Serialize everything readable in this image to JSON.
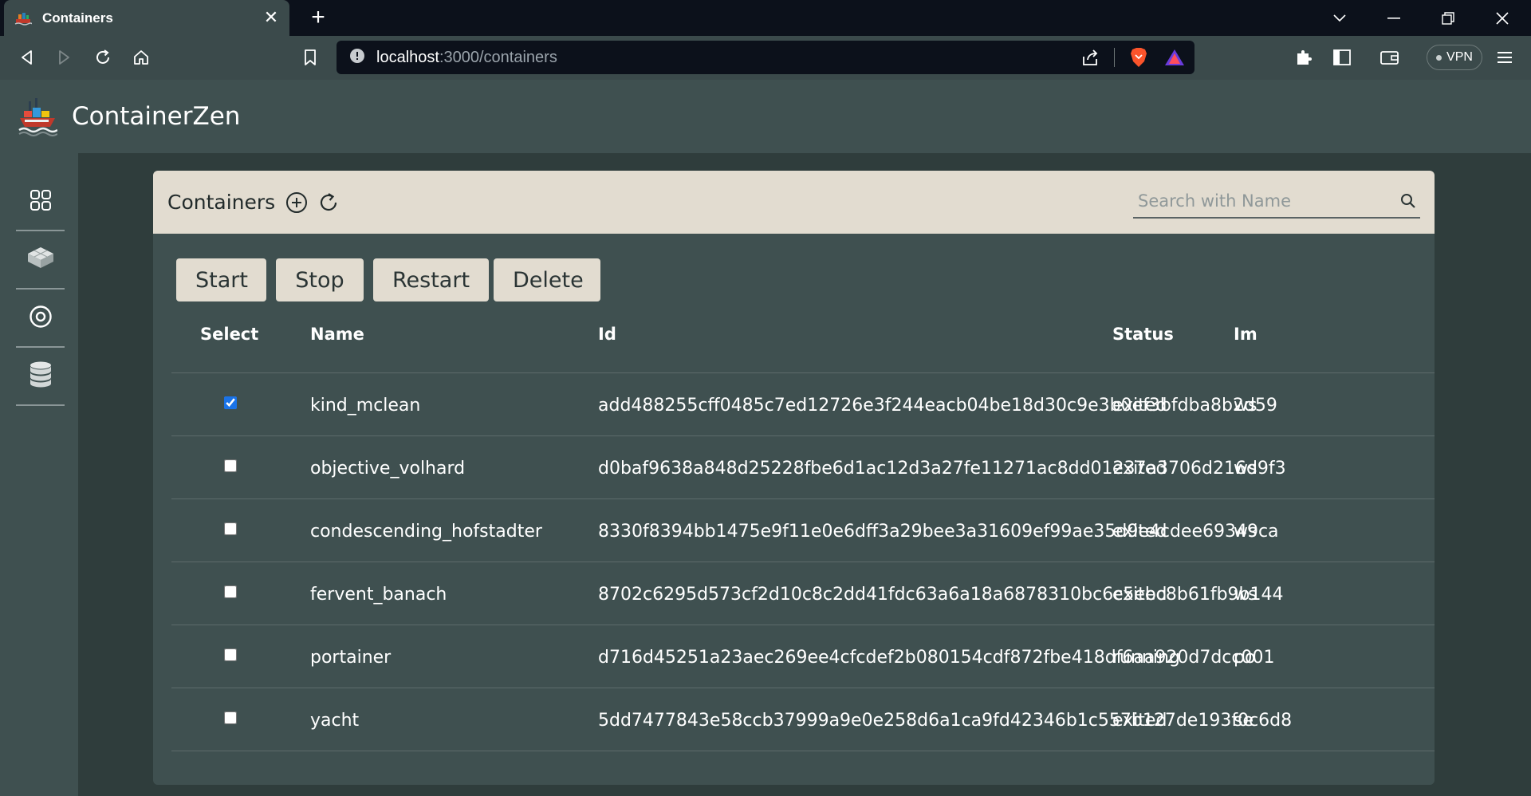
{
  "browser": {
    "tab_title": "Containers",
    "tab_close": "✕",
    "new_tab": "+",
    "url_host": "localhost",
    "url_path": ":3000/containers",
    "vpn_label": "VPN"
  },
  "app": {
    "title": "ContainerZen"
  },
  "sidebar": {
    "items": [
      {
        "icon": "dashboard-grid-icon"
      },
      {
        "icon": "image-layers-icon"
      },
      {
        "icon": "volume-target-icon"
      },
      {
        "icon": "database-icon"
      }
    ]
  },
  "containers_panel": {
    "title": "Containers",
    "search_placeholder": "Search with Name",
    "actions": [
      "Start",
      "Stop",
      "Restart",
      "Delete"
    ],
    "columns": [
      "Select",
      "Name",
      "Id",
      "Status",
      "Im"
    ],
    "rows": [
      {
        "checked": true,
        "name": "kind_mclean",
        "id": "add488255cff0485c7ed12726e3f244eacb04be18d30c9e3b0ef3bfdba8b2d59",
        "status": "exited",
        "image": "ws"
      },
      {
        "checked": false,
        "name": "objective_volhard",
        "id": "d0baf9638a848d25228fbe6d1ac12d3a27fe11271ac8dd01237a3706d216d9f3",
        "status": "exited",
        "image": "ws"
      },
      {
        "checked": false,
        "name": "condescending_hofstadter",
        "id": "8330f8394bb1475e9f11e0e6dff3a29bee3a31609ef99ae35d9e4cdee69349ca",
        "status": "exited",
        "image": "ws"
      },
      {
        "checked": false,
        "name": "fervent_banach",
        "id": "8702c6295d573cf2d10c8c2dd41fdc63a6a18a6878310bc6c5ebc8b61fb9b144",
        "status": "exited",
        "image": "ws"
      },
      {
        "checked": false,
        "name": "portainer",
        "id": "d716d45251a23aec269ee4cfcdef2b080154cdf872fbe418df6aa920d7dcc001",
        "status": "running",
        "image": "po"
      },
      {
        "checked": false,
        "name": "yacht",
        "id": "5dd7477843e58ccb37999a9e0e258d6a1ca9fd42346b1c557b127de193f0c6d8",
        "status": "exited",
        "image": "se"
      }
    ]
  },
  "colors": {
    "header_bg": "#e2dcd0",
    "panel_bg": "#3f5050",
    "main_bg": "#2f3d3c",
    "chrome_bg": "#0c111b"
  }
}
